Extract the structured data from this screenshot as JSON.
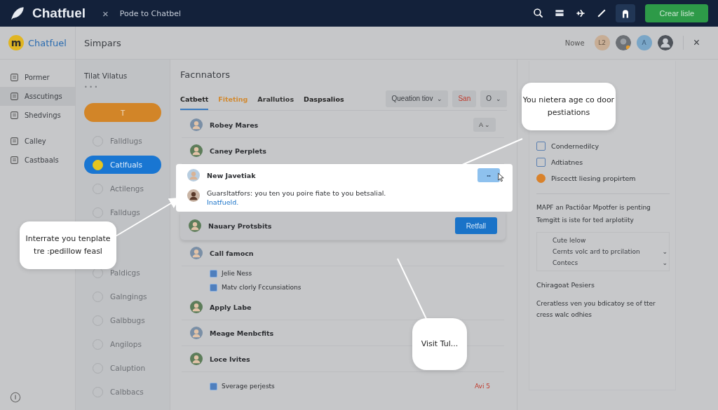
{
  "topbar": {
    "brand": "Chatfuel",
    "close": "×",
    "breadcrumb": "Pode to Chatbel",
    "action": "Crear lisle"
  },
  "header": {
    "logo_letter": "m",
    "brand": "Chatfuel",
    "title": "Simpars",
    "status": "Nowe",
    "badge": "L2",
    "avatar_letter": "A",
    "close": "×"
  },
  "nav": [
    {
      "label": "Pormer",
      "selected": false
    },
    {
      "label": "Asscutings",
      "selected": true
    },
    {
      "label": "Shedvings",
      "selected": false
    },
    {
      "label": "Calley",
      "selected": false
    },
    {
      "label": "Castbaals",
      "selected": false
    }
  ],
  "flows": {
    "title": "Tilat Vilatus",
    "dots": "• • •",
    "button": "T",
    "items": [
      {
        "label": "Falldlugs",
        "selected": false
      },
      {
        "label": "Catlfuals",
        "selected": true
      },
      {
        "label": "Actilengs",
        "selected": false
      },
      {
        "label": "Falldugs",
        "selected": false
      },
      {
        "kind": "gap"
      },
      {
        "label": "Paldicgs",
        "selected": false
      },
      {
        "label": "Galngings",
        "selected": false
      },
      {
        "label": "Galbbugs",
        "selected": false
      },
      {
        "label": "Angilops",
        "selected": false
      },
      {
        "label": "Caluption",
        "selected": false
      },
      {
        "label": "Calbbacs",
        "selected": false
      }
    ]
  },
  "main": {
    "title": "Facnnators",
    "tabs": [
      {
        "label": "Catbett",
        "selected": true,
        "color": "#222222"
      },
      {
        "label": "Fiteting",
        "selected": false,
        "color": "#d2892f"
      },
      {
        "label": "Arallutios",
        "selected": false,
        "color": "#333333"
      },
      {
        "label": "Daspsalios",
        "selected": false,
        "color": "#222222"
      }
    ],
    "filters": [
      {
        "label": "Queation tiov",
        "caret": "⌄",
        "danger": false
      },
      {
        "label": "San",
        "danger": true
      },
      {
        "label": "O",
        "caret": "⌄",
        "danger": false
      }
    ],
    "rows": [
      {
        "kind": "person",
        "name": "Robey Mares",
        "menu": "A ⌄"
      },
      {
        "kind": "person",
        "name": "Caney Perplets"
      },
      {
        "kind": "card",
        "name": "New Javetiak",
        "button": "••",
        "message": "Guarsltatfors: you ten you poire fiate to you betsalial.",
        "link": "Inatfueld."
      },
      {
        "kind": "person",
        "name": "Nauary Protsbits",
        "action": "Retfall"
      },
      {
        "kind": "person",
        "name": "Call famocn"
      },
      {
        "kind": "sub",
        "name": "Jelie Ness"
      },
      {
        "kind": "sub",
        "name": "Matv clorly Fccunsiations"
      },
      {
        "kind": "person",
        "name": "Apply Labe"
      },
      {
        "kind": "person",
        "name": "Meage Menbcfits"
      },
      {
        "kind": "person",
        "name": "Loce Ivites"
      },
      {
        "kind": "sub",
        "name": "Sverage perjests",
        "note": "Avi 5"
      }
    ]
  },
  "side": {
    "items": [
      "Condernedilcy",
      "Adtiatnes",
      "Piscectt liesing propirtem"
    ],
    "line_1": "MAPF an Pactiôar Mpotfer is penting",
    "line_2": "Temgitt is iste for ted arplotiity",
    "box": {
      "title": "Cute lelow",
      "options": [
        {
          "label": "Cernts volc ard to prcilation",
          "caret": "⌄"
        },
        {
          "label": "Contecs",
          "caret": "⌄"
        }
      ]
    },
    "heading": "Chiragoat Pesiers",
    "paragraph": "Creratless ven you bdicatoy se of tter cress walc odhies"
  },
  "callouts": [
    {
      "kind": "left",
      "text": "Interrate you tenplate tre :pedillow feasl"
    },
    {
      "kind": "right",
      "text": "You nietera age co door pestiations"
    },
    {
      "kind": "bottom",
      "text": "Visit Tul..."
    }
  ]
}
